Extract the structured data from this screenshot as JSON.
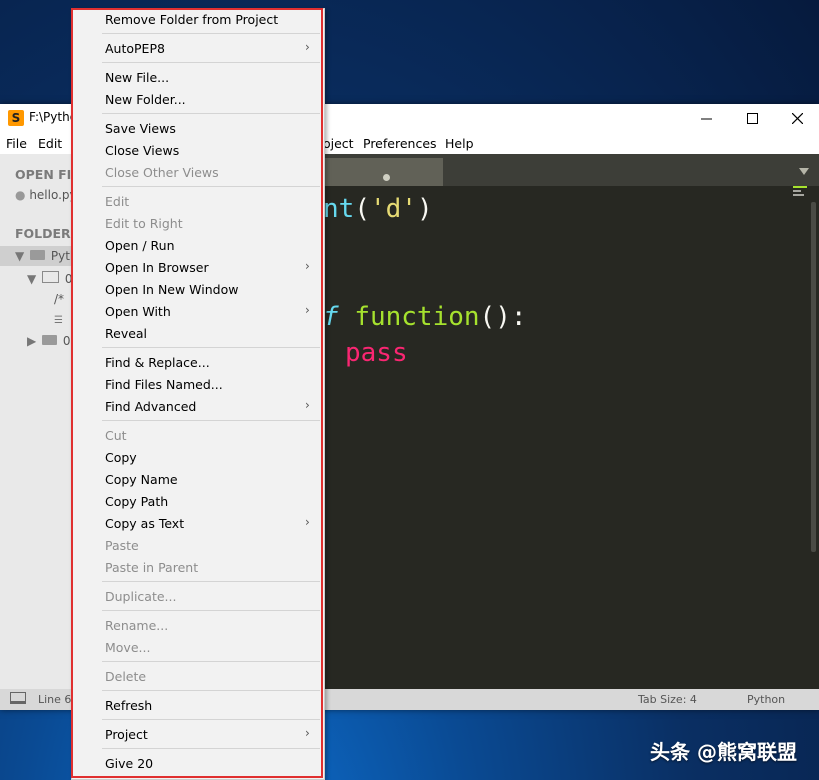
{
  "window": {
    "title": "F:\\Pytho",
    "icon_letter": "S"
  },
  "menubar": {
    "file": "File",
    "edit": "Edit",
    "project": "oject",
    "preferences": "Preferences",
    "help": "Help"
  },
  "sidebar": {
    "open_files_header": "OPEN FIL",
    "open_file": "hello.py",
    "folders_header": "FOLDERS",
    "root_folder": "Pyth",
    "sub_folder_1": "0",
    "file_1": "/*",
    "file_2": "",
    "sub_folder_2": "0"
  },
  "editor": {
    "line1_fn": "nt",
    "line1_open": "(",
    "line1_str": "'d'",
    "line1_close": ")",
    "line2_kw": "f",
    "line2_name": "function",
    "line2_rest": "():",
    "line3_kw": "pass"
  },
  "statusbar": {
    "position": "Line 6,",
    "tab_size": "Tab Size: 4",
    "syntax": "Python"
  },
  "context_menu": {
    "remove_folder": "Remove Folder from Project",
    "autopep8": "AutoPEP8",
    "new_file": "New File...",
    "new_folder": "New Folder...",
    "save_views": "Save Views",
    "close_views": "Close Views",
    "close_other_views": "Close Other Views",
    "edit": "Edit",
    "edit_to_right": "Edit to Right",
    "open_run": "Open / Run",
    "open_in_browser": "Open In Browser",
    "open_in_new_window": "Open In New Window",
    "open_with": "Open With",
    "reveal": "Reveal",
    "find_replace": "Find & Replace...",
    "find_files_named": "Find Files Named...",
    "find_advanced": "Find Advanced",
    "cut": "Cut",
    "copy": "Copy",
    "copy_name": "Copy Name",
    "copy_path": "Copy Path",
    "copy_as_text": "Copy as Text",
    "paste": "Paste",
    "paste_in_parent": "Paste in Parent",
    "duplicate": "Duplicate...",
    "rename": "Rename...",
    "move": "Move...",
    "delete": "Delete",
    "refresh": "Refresh",
    "project": "Project",
    "give": "Give 20",
    "submenu_chevron": "›"
  },
  "watermark": "头条 @熊窝联盟",
  "colors": {
    "accent_highlight": "#e03030",
    "editor_bg": "#272822",
    "function_color": "#66d9ef",
    "string_color": "#e6db74",
    "keyword_color": "#f92672",
    "name_color": "#a6e22e"
  }
}
